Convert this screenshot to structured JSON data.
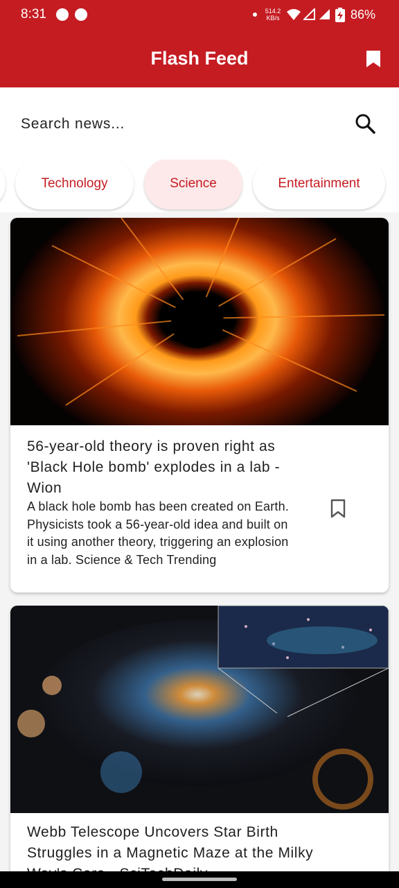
{
  "status_bar": {
    "time": "8:31",
    "net_speed_value": "514.2",
    "net_speed_unit": "KB/s",
    "battery_percent": "86%"
  },
  "app_bar": {
    "title": "Flash Feed",
    "bookmarks_icon": "bookmark-icon"
  },
  "search": {
    "placeholder": "Search news...",
    "icon": "search-icon"
  },
  "categories": {
    "items": [
      "Technology",
      "Science",
      "Entertainment"
    ],
    "selected": "Science"
  },
  "articles": [
    {
      "title": "56-year-old theory is proven right as 'Black Hole bomb' explodes in a lab - Wion",
      "description": "A black hole bomb has been created on Earth. Physicists took a 56-year-old idea and built on it using another theory, triggering an explosion in a lab. Science & Tech Trending",
      "bookmark_icon": "bookmark-outline-icon"
    },
    {
      "title": "Webb Telescope Uncovers Star Birth Struggles in a Magnetic Maze at the Milky Way's Core - SciTechDaily",
      "description": ""
    }
  ],
  "colors": {
    "primary": "#c51c22",
    "chip_selected_bg": "#fde9ea",
    "background": "#f4f4f4"
  }
}
